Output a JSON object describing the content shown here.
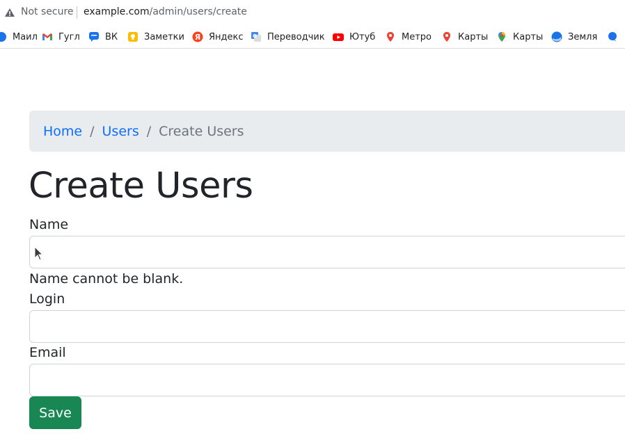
{
  "browser": {
    "security_text": "Not secure",
    "url_host": "example.com",
    "url_path": "/admin/users/create"
  },
  "bookmarks": [
    {
      "label": "Маил",
      "icon": "mail-ru-icon",
      "color": "#1a73e8"
    },
    {
      "label": "Гугл",
      "icon": "gmail-icon",
      "color": "#ea4335"
    },
    {
      "label": "ВК",
      "icon": "vk-chat-icon",
      "color": "#1a73e8"
    },
    {
      "label": "Заметки",
      "icon": "keep-notes-icon",
      "color": "#fbbc04"
    },
    {
      "label": "Яндекс",
      "icon": "yandex-icon",
      "color": "#fc3f1d"
    },
    {
      "label": "Переводчик",
      "icon": "translate-icon",
      "color": "#4285f4"
    },
    {
      "label": "Ютуб",
      "icon": "youtube-icon",
      "color": "#ff0000"
    },
    {
      "label": "Метро",
      "icon": "map-pin-icon",
      "color": "#ea4335"
    },
    {
      "label": "Карты",
      "icon": "map-pin-icon",
      "color": "#ea4335"
    },
    {
      "label": "Карты",
      "icon": "google-maps-icon",
      "color": "#34a853"
    },
    {
      "label": "Земля",
      "icon": "earth-icon",
      "color": "#1a73e8"
    }
  ],
  "breadcrumb": {
    "home": "Home",
    "users": "Users",
    "current": "Create Users",
    "separator": "/"
  },
  "page": {
    "title": "Create Users"
  },
  "form": {
    "name_label": "Name",
    "name_value": "",
    "name_error": "Name cannot be blank.",
    "login_label": "Login",
    "login_value": "",
    "email_label": "Email",
    "email_value": "",
    "save_label": "Save"
  },
  "colors": {
    "link": "#0d6efd",
    "breadcrumb_bg": "#e9ecef",
    "save_button": "#198754"
  }
}
